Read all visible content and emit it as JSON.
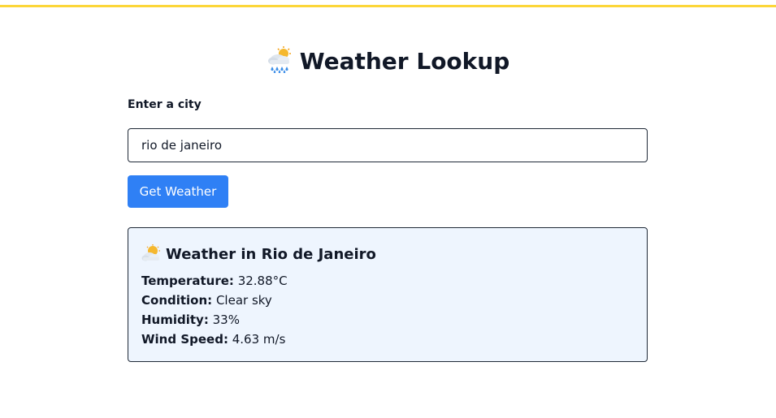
{
  "header": {
    "title": "Weather Lookup",
    "icon": "cloud-rain-sun-icon",
    "accent_color": "#fcd638"
  },
  "form": {
    "label": "Enter a city",
    "input_value": "rio de janeiro",
    "button_label": "Get Weather",
    "button_color": "#2f80f5"
  },
  "result": {
    "icon": "sun-behind-cloud-icon",
    "title": "Weather in Rio de Janeiro",
    "background": "#eef5fe",
    "rows": [
      {
        "label": "Temperature:",
        "value": "32.88°C"
      },
      {
        "label": "Condition:",
        "value": "Clear sky"
      },
      {
        "label": "Humidity:",
        "value": "33%"
      },
      {
        "label": "Wind Speed:",
        "value": "4.63 m/s"
      }
    ]
  }
}
